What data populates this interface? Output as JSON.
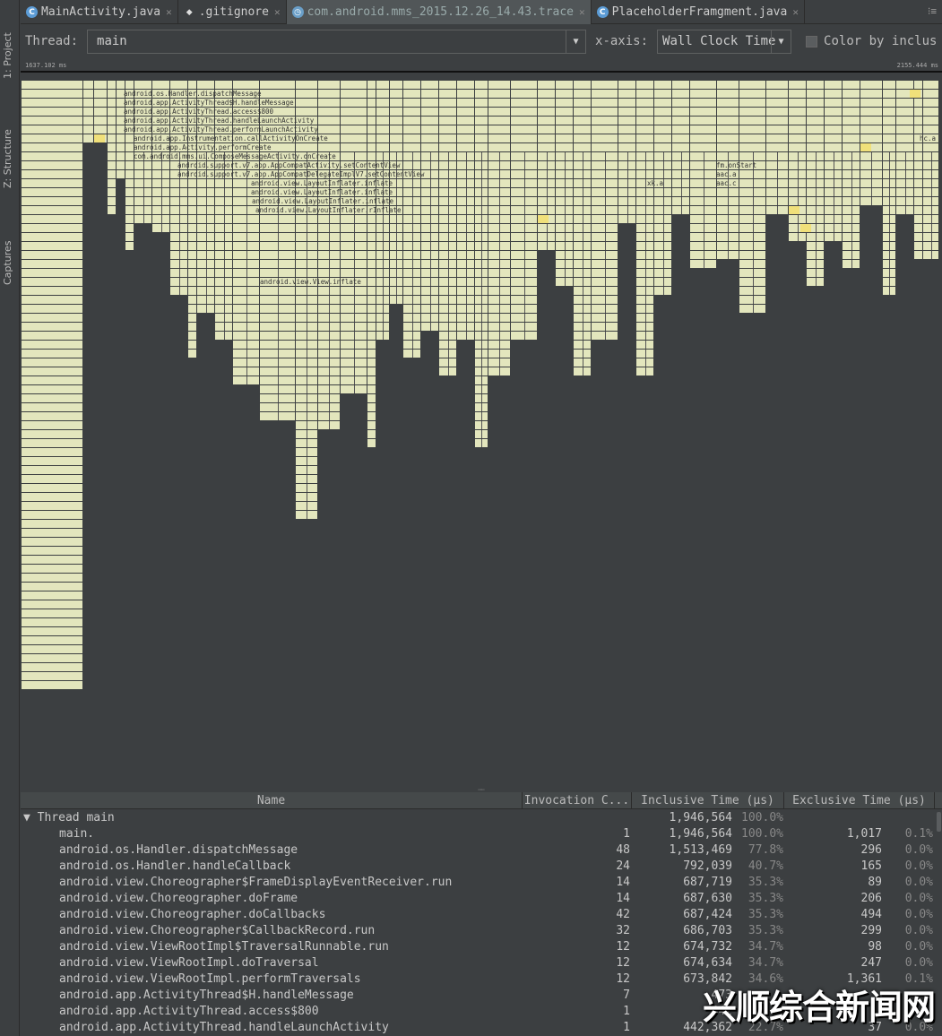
{
  "sidebar": {
    "items": [
      {
        "label": "1: Project",
        "icon": "project-icon"
      },
      {
        "label": "Z: Structure",
        "icon": "structure-icon"
      },
      {
        "label": "Captures",
        "icon": "captures-icon"
      }
    ]
  },
  "tabs": [
    {
      "label": "MainActivity.java",
      "icon": "class-icon",
      "active": false
    },
    {
      "label": ".gitignore",
      "icon": "git-icon",
      "active": false
    },
    {
      "label": "com.android.mms_2015.12.26_14.43.trace",
      "icon": "trace-icon",
      "active": true
    },
    {
      "label": "PlaceholderFramgment.java",
      "icon": "class-icon",
      "active": false
    }
  ],
  "toolbar": {
    "thread_label": "Thread:",
    "thread_value": "main",
    "xaxis_label": "x-axis:",
    "xaxis_value": "Wall Clock Time",
    "color_checkbox_label": "Color by inclus",
    "color_checked": false
  },
  "ruler": {
    "start": "1637.102 ms",
    "end": "2155.444 ms"
  },
  "flame": {
    "colors": {
      "bar": "#e3e6bd",
      "highlight": "#f0e07a",
      "background": "#3c3f41"
    },
    "labels": [
      "android.os.Handler.dispatchMessage",
      "android.app.ActivityThread$H.handleMessage",
      "android.app.ActivityThread.access$800",
      "android.app.ActivityThread.handleLaunchActivity",
      "android.app.ActivityThread.performLaunchActivity",
      "android.app.Instrumentation.callActivityOnCreate",
      "android.app.Activity.performCreate",
      "com.android.mms.ui.ComposeMessageActivity.onCreate",
      "android.support.v7.app.AppCompatActivity.setContentView",
      "android.support.v7.app.AppCompatDelegateImplV7.setContentView",
      "android.view.LayoutInflater.inflate",
      "android.view.LayoutInflater.inflate",
      "android.view.LayoutInflater.inflate",
      "android.view.LayoutInflater.rInflate",
      "android.view.View.inflate",
      "fm.onStart",
      "aac.a",
      "aac.c",
      "xk.a",
      "hc.a"
    ]
  },
  "table": {
    "headers": [
      "Name",
      "Invocation C...",
      "Inclusive Time (µs)",
      "Exclusive Time (µs)"
    ],
    "group": {
      "name": "Thread main",
      "inclusive": "1,946,564",
      "inclusive_pct": "100.0%"
    },
    "rows": [
      {
        "name": "main.",
        "inv": "1",
        "inc": "1,946,564",
        "incp": "100.0%",
        "exc": "1,017",
        "excp": "0.1%"
      },
      {
        "name": "android.os.Handler.dispatchMessage",
        "inv": "48",
        "inc": "1,513,469",
        "incp": "77.8%",
        "exc": "296",
        "excp": "0.0%"
      },
      {
        "name": "android.os.Handler.handleCallback",
        "inv": "24",
        "inc": "792,039",
        "incp": "40.7%",
        "exc": "165",
        "excp": "0.0%"
      },
      {
        "name": "android.view.Choreographer$FrameDisplayEventReceiver.run",
        "inv": "14",
        "inc": "687,719",
        "incp": "35.3%",
        "exc": "89",
        "excp": "0.0%"
      },
      {
        "name": "android.view.Choreographer.doFrame",
        "inv": "14",
        "inc": "687,630",
        "incp": "35.3%",
        "exc": "206",
        "excp": "0.0%"
      },
      {
        "name": "android.view.Choreographer.doCallbacks",
        "inv": "42",
        "inc": "687,424",
        "incp": "35.3%",
        "exc": "494",
        "excp": "0.0%"
      },
      {
        "name": "android.view.Choreographer$CallbackRecord.run",
        "inv": "32",
        "inc": "686,703",
        "incp": "35.3%",
        "exc": "299",
        "excp": "0.0%"
      },
      {
        "name": "android.view.ViewRootImpl$TraversalRunnable.run",
        "inv": "12",
        "inc": "674,732",
        "incp": "34.7%",
        "exc": "98",
        "excp": "0.0%"
      },
      {
        "name": "android.view.ViewRootImpl.doTraversal",
        "inv": "12",
        "inc": "674,634",
        "incp": "34.7%",
        "exc": "247",
        "excp": "0.0%"
      },
      {
        "name": "android.view.ViewRootImpl.performTraversals",
        "inv": "12",
        "inc": "673,842",
        "incp": "34.6%",
        "exc": "1,361",
        "excp": "0.1%"
      },
      {
        "name": "android.app.ActivityThread$H.handleMessage",
        "inv": "7",
        "inc": "473",
        "incp": "",
        "exc": "",
        "excp": ""
      },
      {
        "name": "android.app.ActivityThread.access$800",
        "inv": "1",
        "inc": "442",
        "incp": "",
        "exc": "",
        "excp": ""
      },
      {
        "name": "android.app.ActivityThread.handleLaunchActivity",
        "inv": "1",
        "inc": "442,362",
        "incp": "22.7%",
        "exc": "37",
        "excp": "0.0%"
      }
    ]
  },
  "watermark": "兴顺综合新闻网"
}
